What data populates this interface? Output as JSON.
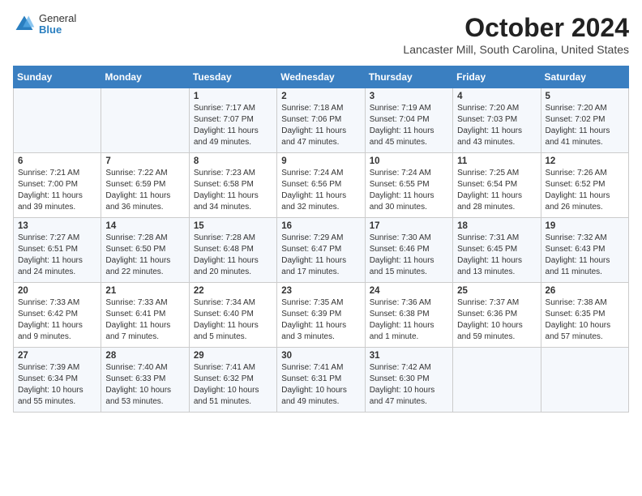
{
  "logo": {
    "general": "General",
    "blue": "Blue"
  },
  "title": "October 2024",
  "location": "Lancaster Mill, South Carolina, United States",
  "days_of_week": [
    "Sunday",
    "Monday",
    "Tuesday",
    "Wednesday",
    "Thursday",
    "Friday",
    "Saturday"
  ],
  "weeks": [
    [
      {
        "day": "",
        "content": ""
      },
      {
        "day": "",
        "content": ""
      },
      {
        "day": "1",
        "content": "Sunrise: 7:17 AM\nSunset: 7:07 PM\nDaylight: 11 hours and 49 minutes."
      },
      {
        "day": "2",
        "content": "Sunrise: 7:18 AM\nSunset: 7:06 PM\nDaylight: 11 hours and 47 minutes."
      },
      {
        "day": "3",
        "content": "Sunrise: 7:19 AM\nSunset: 7:04 PM\nDaylight: 11 hours and 45 minutes."
      },
      {
        "day": "4",
        "content": "Sunrise: 7:20 AM\nSunset: 7:03 PM\nDaylight: 11 hours and 43 minutes."
      },
      {
        "day": "5",
        "content": "Sunrise: 7:20 AM\nSunset: 7:02 PM\nDaylight: 11 hours and 41 minutes."
      }
    ],
    [
      {
        "day": "6",
        "content": "Sunrise: 7:21 AM\nSunset: 7:00 PM\nDaylight: 11 hours and 39 minutes."
      },
      {
        "day": "7",
        "content": "Sunrise: 7:22 AM\nSunset: 6:59 PM\nDaylight: 11 hours and 36 minutes."
      },
      {
        "day": "8",
        "content": "Sunrise: 7:23 AM\nSunset: 6:58 PM\nDaylight: 11 hours and 34 minutes."
      },
      {
        "day": "9",
        "content": "Sunrise: 7:24 AM\nSunset: 6:56 PM\nDaylight: 11 hours and 32 minutes."
      },
      {
        "day": "10",
        "content": "Sunrise: 7:24 AM\nSunset: 6:55 PM\nDaylight: 11 hours and 30 minutes."
      },
      {
        "day": "11",
        "content": "Sunrise: 7:25 AM\nSunset: 6:54 PM\nDaylight: 11 hours and 28 minutes."
      },
      {
        "day": "12",
        "content": "Sunrise: 7:26 AM\nSunset: 6:52 PM\nDaylight: 11 hours and 26 minutes."
      }
    ],
    [
      {
        "day": "13",
        "content": "Sunrise: 7:27 AM\nSunset: 6:51 PM\nDaylight: 11 hours and 24 minutes."
      },
      {
        "day": "14",
        "content": "Sunrise: 7:28 AM\nSunset: 6:50 PM\nDaylight: 11 hours and 22 minutes."
      },
      {
        "day": "15",
        "content": "Sunrise: 7:28 AM\nSunset: 6:48 PM\nDaylight: 11 hours and 20 minutes."
      },
      {
        "day": "16",
        "content": "Sunrise: 7:29 AM\nSunset: 6:47 PM\nDaylight: 11 hours and 17 minutes."
      },
      {
        "day": "17",
        "content": "Sunrise: 7:30 AM\nSunset: 6:46 PM\nDaylight: 11 hours and 15 minutes."
      },
      {
        "day": "18",
        "content": "Sunrise: 7:31 AM\nSunset: 6:45 PM\nDaylight: 11 hours and 13 minutes."
      },
      {
        "day": "19",
        "content": "Sunrise: 7:32 AM\nSunset: 6:43 PM\nDaylight: 11 hours and 11 minutes."
      }
    ],
    [
      {
        "day": "20",
        "content": "Sunrise: 7:33 AM\nSunset: 6:42 PM\nDaylight: 11 hours and 9 minutes."
      },
      {
        "day": "21",
        "content": "Sunrise: 7:33 AM\nSunset: 6:41 PM\nDaylight: 11 hours and 7 minutes."
      },
      {
        "day": "22",
        "content": "Sunrise: 7:34 AM\nSunset: 6:40 PM\nDaylight: 11 hours and 5 minutes."
      },
      {
        "day": "23",
        "content": "Sunrise: 7:35 AM\nSunset: 6:39 PM\nDaylight: 11 hours and 3 minutes."
      },
      {
        "day": "24",
        "content": "Sunrise: 7:36 AM\nSunset: 6:38 PM\nDaylight: 11 hours and 1 minute."
      },
      {
        "day": "25",
        "content": "Sunrise: 7:37 AM\nSunset: 6:36 PM\nDaylight: 10 hours and 59 minutes."
      },
      {
        "day": "26",
        "content": "Sunrise: 7:38 AM\nSunset: 6:35 PM\nDaylight: 10 hours and 57 minutes."
      }
    ],
    [
      {
        "day": "27",
        "content": "Sunrise: 7:39 AM\nSunset: 6:34 PM\nDaylight: 10 hours and 55 minutes."
      },
      {
        "day": "28",
        "content": "Sunrise: 7:40 AM\nSunset: 6:33 PM\nDaylight: 10 hours and 53 minutes."
      },
      {
        "day": "29",
        "content": "Sunrise: 7:41 AM\nSunset: 6:32 PM\nDaylight: 10 hours and 51 minutes."
      },
      {
        "day": "30",
        "content": "Sunrise: 7:41 AM\nSunset: 6:31 PM\nDaylight: 10 hours and 49 minutes."
      },
      {
        "day": "31",
        "content": "Sunrise: 7:42 AM\nSunset: 6:30 PM\nDaylight: 10 hours and 47 minutes."
      },
      {
        "day": "",
        "content": ""
      },
      {
        "day": "",
        "content": ""
      }
    ]
  ]
}
